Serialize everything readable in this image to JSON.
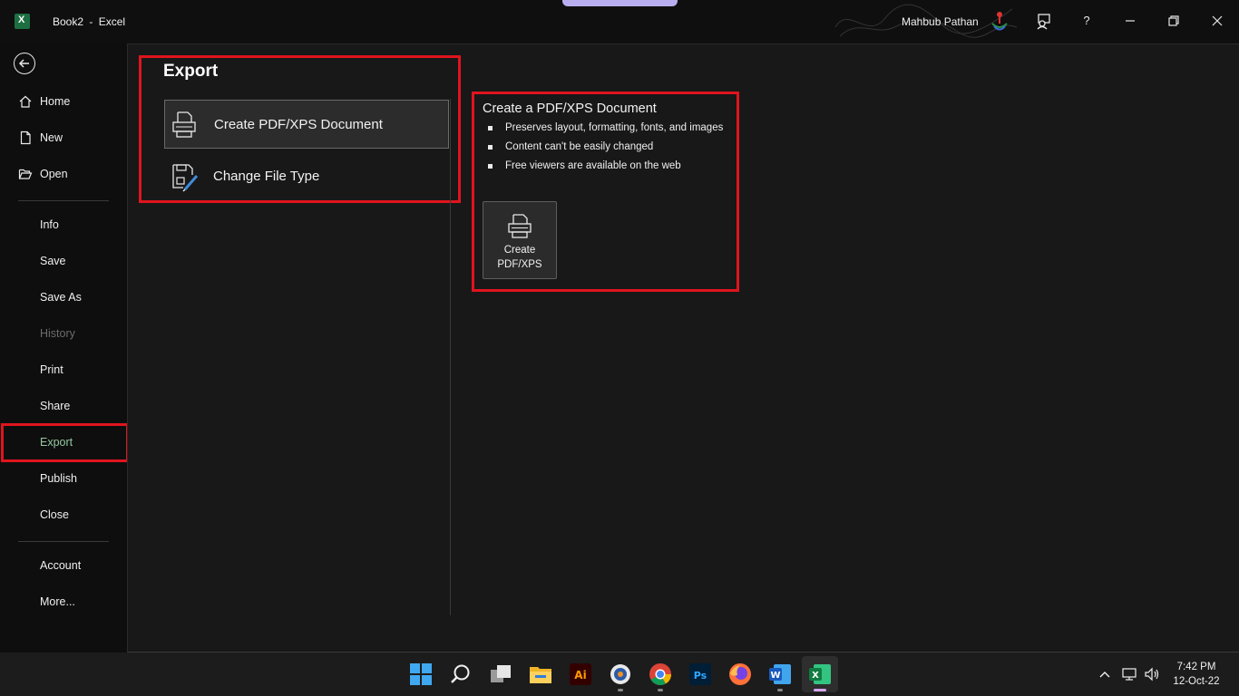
{
  "window": {
    "doc_name": "Book2",
    "separator": "-",
    "app_name": "Excel",
    "user_name": "Mahbub Pathan",
    "help_label": "?"
  },
  "nav": {
    "items": [
      {
        "label": "Home",
        "icon": "home-icon"
      },
      {
        "label": "New",
        "icon": "new-document-icon"
      },
      {
        "label": "Open",
        "icon": "folder-open-icon"
      },
      {
        "label": "Info"
      },
      {
        "label": "Save"
      },
      {
        "label": "Save As"
      },
      {
        "label": "History",
        "disabled": true
      },
      {
        "label": "Print"
      },
      {
        "label": "Share"
      },
      {
        "label": "Export",
        "selected": true
      },
      {
        "label": "Publish"
      },
      {
        "label": "Close"
      },
      {
        "label": "Account"
      },
      {
        "label": "More..."
      }
    ]
  },
  "export": {
    "title": "Export",
    "options": [
      {
        "label": "Create PDF/XPS Document",
        "icon": "pdf-printer-icon",
        "selected": true
      },
      {
        "label": "Change File Type",
        "icon": "change-file-type-icon"
      }
    ],
    "detail": {
      "title": "Create a PDF/XPS Document",
      "bullets": [
        "Preserves layout, formatting, fonts, and images",
        "Content can't be easily changed",
        "Free viewers are available on the web"
      ],
      "button_line1": "Create",
      "button_line2": "PDF/XPS"
    }
  },
  "taskbar": {
    "apps": [
      "windows-start-icon",
      "search-icon",
      "task-view-icon",
      "file-explorer-icon",
      "illustrator-icon",
      "media-app-icon",
      "chrome-icon",
      "photoshop-icon",
      "firefox-icon",
      "word-icon",
      "excel-icon"
    ],
    "time": "7:42 PM",
    "date": "12-Oct-22"
  },
  "colors": {
    "highlight": "#e0141e",
    "selected_nav_text": "#94c8a0",
    "excel_green": "#1d6f42"
  }
}
